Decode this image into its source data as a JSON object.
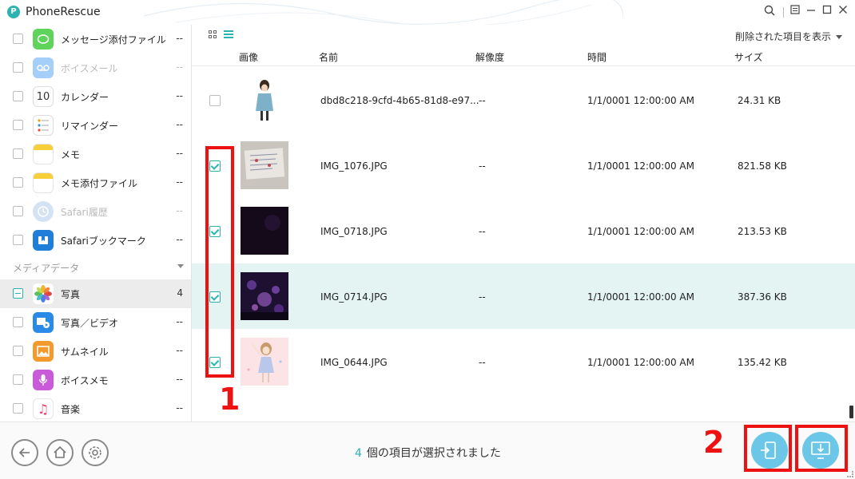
{
  "app": {
    "title": "PhoneRescue",
    "logo_letter": "P"
  },
  "sidebar": {
    "items": [
      {
        "label": "メッセージ添付ファイル",
        "count": "--",
        "icon": "message-attachment-icon",
        "disabled": false
      },
      {
        "label": "ボイスメール",
        "count": "--",
        "icon": "voicemail-icon",
        "disabled": true
      },
      {
        "label": "カレンダー",
        "count": "--",
        "icon": "calendar-icon",
        "disabled": false,
        "icon_text": "10"
      },
      {
        "label": "リマインダー",
        "count": "--",
        "icon": "reminders-icon",
        "disabled": false
      },
      {
        "label": "メモ",
        "count": "--",
        "icon": "notes-icon",
        "disabled": false
      },
      {
        "label": "メモ添付ファイル",
        "count": "--",
        "icon": "notes-attachment-icon",
        "disabled": false
      },
      {
        "label": "Safari履歴",
        "count": "--",
        "icon": "safari-history-icon",
        "disabled": true
      },
      {
        "label": "Safariブックマーク",
        "count": "--",
        "icon": "safari-bookmark-icon",
        "disabled": false
      }
    ],
    "media_section": "メディアデータ",
    "media_items": [
      {
        "label": "写真",
        "count": "4",
        "icon": "photos-icon",
        "selected": true
      },
      {
        "label": "写真／ビデオ",
        "count": "--",
        "icon": "photo-video-icon",
        "selected": false
      },
      {
        "label": "サムネイル",
        "count": "--",
        "icon": "thumbnail-icon",
        "selected": false
      },
      {
        "label": "ボイスメモ",
        "count": "--",
        "icon": "voice-memo-icon",
        "selected": false
      },
      {
        "label": "音楽",
        "count": "--",
        "icon": "music-icon",
        "selected": false
      }
    ]
  },
  "toolbar": {
    "show_deleted": "削除された項目を表示"
  },
  "table": {
    "headers": {
      "image": "画像",
      "name": "名前",
      "resolution": "解像度",
      "time": "時間",
      "size": "サイズ"
    },
    "rows": [
      {
        "name": "dbd8c218-9cfd-4b65-81d8-e97...",
        "resolution": "--",
        "time": "1/1/0001 12:00:00 AM",
        "size": "24.31 KB",
        "checked": false
      },
      {
        "name": "IMG_1076.JPG",
        "resolution": "--",
        "time": "1/1/0001 12:00:00 AM",
        "size": "821.58 KB",
        "checked": true
      },
      {
        "name": "IMG_0718.JPG",
        "resolution": "--",
        "time": "1/1/0001 12:00:00 AM",
        "size": "213.53 KB",
        "checked": true
      },
      {
        "name": "IMG_0714.JPG",
        "resolution": "--",
        "time": "1/1/0001 12:00:00 AM",
        "size": "387.36 KB",
        "checked": true
      },
      {
        "name": "IMG_0644.JPG",
        "resolution": "--",
        "time": "1/1/0001 12:00:00 AM",
        "size": "135.42 KB",
        "checked": true
      }
    ]
  },
  "status": {
    "count": "4",
    "text": "個の項目が選択されました"
  },
  "annotations": {
    "one": "1",
    "two": "2"
  },
  "colors": {
    "accent": "#2bb3b0",
    "annotation": "#ee1111",
    "action_button": "#6cc6e8",
    "highlight_row": "#e4f4f2"
  }
}
